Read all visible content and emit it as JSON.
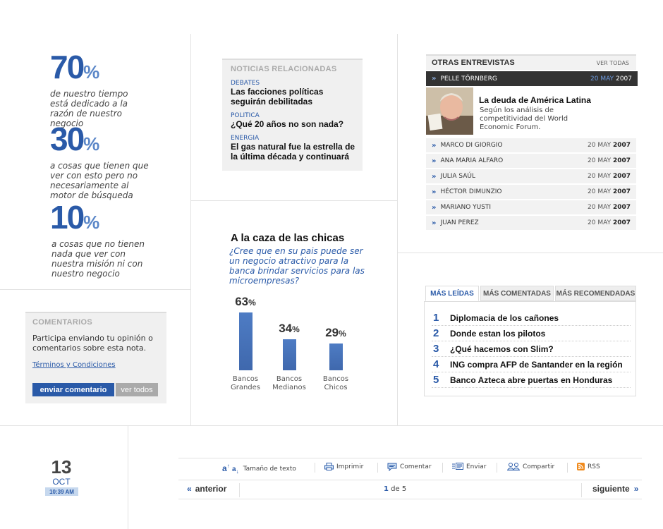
{
  "stats": [
    {
      "value": "70",
      "unit": "%",
      "text": "de nuestro tiempo está dedicado a la razón de nuestro negocio"
    },
    {
      "value": "30",
      "unit": "%",
      "text": "a cosas que tienen que ver con esto pero no necesariamente al motor de búsqueda"
    },
    {
      "value": "10",
      "unit": "%",
      "text": "a cosas que no tienen nada que ver con nuestra misión ni con nuestro negocio"
    }
  ],
  "comments": {
    "title": "COMENTARIOS",
    "text": "Participa enviando tu opinión o comentarios sobre esta nota.",
    "terms": "Términos y Condiciones",
    "send": "enviar comentario",
    "view_all": "ver todos"
  },
  "related": {
    "title": "NOTICIAS RELACIONADAS",
    "items": [
      {
        "cat": "DEBATES",
        "title": "Las facciones políticas seguirán debilitadas"
      },
      {
        "cat": "POLITICA",
        "title": "¿Qué 20 años no son nada?"
      },
      {
        "cat": "ENERGIA",
        "title": "El gas natural fue la estrella de la última década y continuará"
      }
    ]
  },
  "poll": {
    "title": "A la caza de las chicas",
    "question": "¿Cree que en su pais puede ser un negocio atractivo para la banca brindar servicios para las microempresas?",
    "unit": "%",
    "options": [
      {
        "label": "Bancos Grandes",
        "pct": 63
      },
      {
        "label": "Bancos Medianos",
        "pct": 34
      },
      {
        "label": "Bancos Chicos",
        "pct": 29
      }
    ]
  },
  "interviews": {
    "title": "OTRAS ENTREVISTAS",
    "view_all": "VER TODAS",
    "featured": {
      "name": "PELLE TÖRNBERG",
      "date_dm": "20 MAY",
      "date_y": "2007",
      "headline": "La deuda de América Latina",
      "summary": "Según los análisis de competitividad del World Economic Forum."
    },
    "items": [
      {
        "name": "MARCO DI GIORGIO",
        "date_dm": "20 MAY",
        "date_y": "2007"
      },
      {
        "name": "ANA MARIA ALFARO",
        "date_dm": "20 MAY",
        "date_y": "2007"
      },
      {
        "name": "JULIA SAÚL",
        "date_dm": "20 MAY",
        "date_y": "2007"
      },
      {
        "name": "HÉCTOR DIMUNZIO",
        "date_dm": "20 MAY",
        "date_y": "2007"
      },
      {
        "name": "MARIANO YUSTI",
        "date_dm": "20 MAY",
        "date_y": "2007"
      },
      {
        "name": "JUAN PEREZ",
        "date_dm": "20 MAY",
        "date_y": "2007"
      }
    ]
  },
  "most": {
    "tabs": [
      "MÁS LEÍDAS",
      "MÁS COMENTADAS",
      "MÁS RECOMENDADAS"
    ],
    "items": [
      {
        "n": "1",
        "title": "Diplomacia de los cañones"
      },
      {
        "n": "2",
        "title": "Donde estan los pilotos"
      },
      {
        "n": "3",
        "title": "¿Qué hacemos con Slim?"
      },
      {
        "n": "4",
        "title": "ING compra AFP de Santander en la región"
      },
      {
        "n": "5",
        "title": "Banco Azteca abre puertas en Honduras"
      }
    ]
  },
  "date": {
    "day": "13",
    "month": "OCT",
    "time": "10:39 AM"
  },
  "toolbar": {
    "text_size": "Tamaño de texto",
    "print": "Imprimir",
    "comment": "Comentar",
    "send": "Enviar",
    "share": "Compartir",
    "rss": "RSS"
  },
  "pager": {
    "prev": "anterior",
    "current": "1",
    "of": "de 5",
    "next": "siguiente"
  },
  "colors": {
    "accent": "#2a5aa8",
    "dark_bar": "#333333",
    "light_blue": "#5b87c8"
  }
}
